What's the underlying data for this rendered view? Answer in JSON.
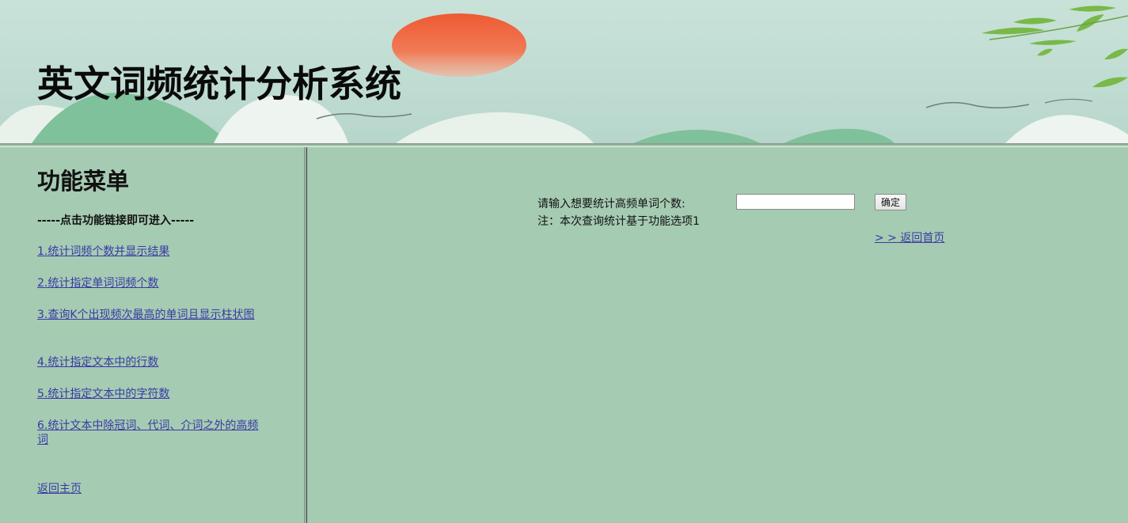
{
  "header": {
    "title": "英文词频统计分析系统"
  },
  "sidebar": {
    "title": "功能菜单",
    "hint": "-----点击功能链接即可进入-----",
    "items": [
      {
        "label": "1.统计词频个数并显示结果"
      },
      {
        "label": "2.统计指定单词词频个数"
      },
      {
        "label": "3.查询K个出现频次最高的单词且显示柱状图"
      },
      {
        "label": "4.统计指定文本中的行数"
      },
      {
        "label": "5.统计指定文本中的字符数"
      },
      {
        "label": "6.统计文本中除冠词、代词、介词之外的高频词"
      }
    ],
    "home_link": "返回主页"
  },
  "main": {
    "prompt_label": "请输入想要统计高频单词个数:",
    "input_value": "",
    "confirm_label": "确定",
    "note": "注：本次查询统计基于功能选项1",
    "back_link": "> > 返回首页"
  },
  "colors": {
    "background": "#a5cbb2",
    "link": "#3a3aa5",
    "sun": "#ef5a34"
  }
}
